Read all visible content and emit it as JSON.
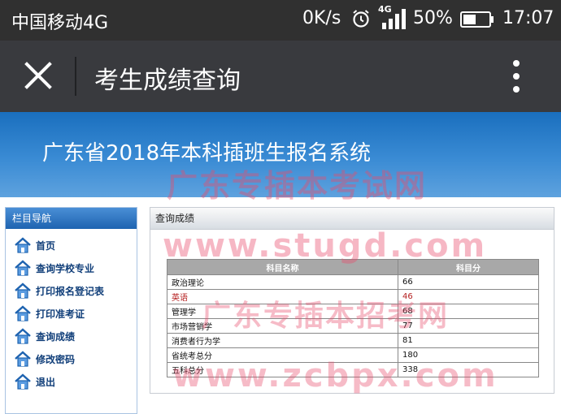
{
  "statusbar": {
    "carrier": "中国移动4G",
    "net_speed": "0K/s",
    "network_type": "4G",
    "battery_percent": "50%",
    "battery_level": 0.5,
    "time": "17:07",
    "icons": [
      "alarm-icon",
      "signal-icon",
      "battery-icon"
    ]
  },
  "toolbar": {
    "title": "考生成绩查询",
    "icons": [
      "close-icon",
      "more-vertical-icon"
    ]
  },
  "banner": {
    "title": "广东省2018年本科插班生报名系统"
  },
  "sidebar": {
    "header": "栏目导航",
    "items": [
      {
        "label": "首页",
        "icon": "home-icon"
      },
      {
        "label": "查询学校专业",
        "icon": "home-icon"
      },
      {
        "label": "打印报名登记表",
        "icon": "home-icon"
      },
      {
        "label": "打印准考证",
        "icon": "home-icon"
      },
      {
        "label": "查询成绩",
        "icon": "home-icon"
      },
      {
        "label": "修改密码",
        "icon": "home-icon"
      },
      {
        "label": "退出",
        "icon": "home-icon"
      }
    ]
  },
  "panel": {
    "header": "查询成绩",
    "table": {
      "columns": [
        "科目名称",
        "科目分"
      ],
      "rows": [
        [
          "政治理论",
          "66"
        ],
        [
          "英语",
          "46"
        ],
        [
          "管理学",
          "68"
        ],
        [
          "市场营销学",
          "77"
        ],
        [
          "消费者行为学",
          "81"
        ],
        [
          "省统考总分",
          "180"
        ],
        [
          "五科总分",
          "338"
        ]
      ]
    }
  },
  "watermarks": [
    "广东专插本考试网",
    "www.stugd.com",
    "广东专插本招考网",
    "www.zcbpx.com"
  ],
  "colors": {
    "statusbar": "#303030",
    "toolbar": "#393a3e",
    "banner": "#1a6fbe",
    "watermark": "#e84c6c"
  }
}
